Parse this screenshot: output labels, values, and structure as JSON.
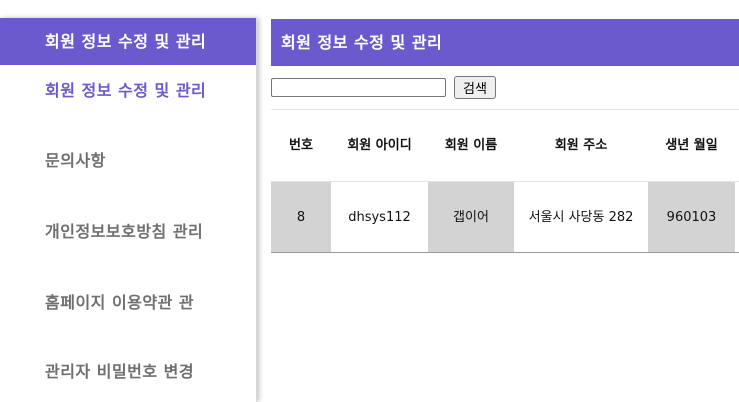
{
  "sidebar": {
    "header": "회원 정보 수정 및 관리",
    "items": [
      {
        "label": "회원 정보 수정 및 관리",
        "active": true
      },
      {
        "label": "문의사항",
        "active": false
      },
      {
        "label": "개인정보보호방침 관리",
        "active": false
      },
      {
        "label": "홈페이지 이용약관 관",
        "active": false
      },
      {
        "label": "관리자 비밀번호 변경",
        "active": false
      }
    ]
  },
  "main": {
    "title": "회원 정보 수정 및 관리",
    "search": {
      "value": "",
      "placeholder": "",
      "button_label": "검색"
    },
    "table": {
      "headers": [
        "번호",
        "회원 아이디",
        "회원 이름",
        "회원 주소",
        "생년 월일"
      ],
      "rows": [
        [
          "8",
          "dhsys112",
          "갭이어",
          "서울시 사당동 282",
          "960103"
        ]
      ]
    }
  },
  "colors": {
    "accent": "#6a5acd",
    "row_gray": "#d3d3d3",
    "sidebar_text": "#6f6f6f"
  }
}
